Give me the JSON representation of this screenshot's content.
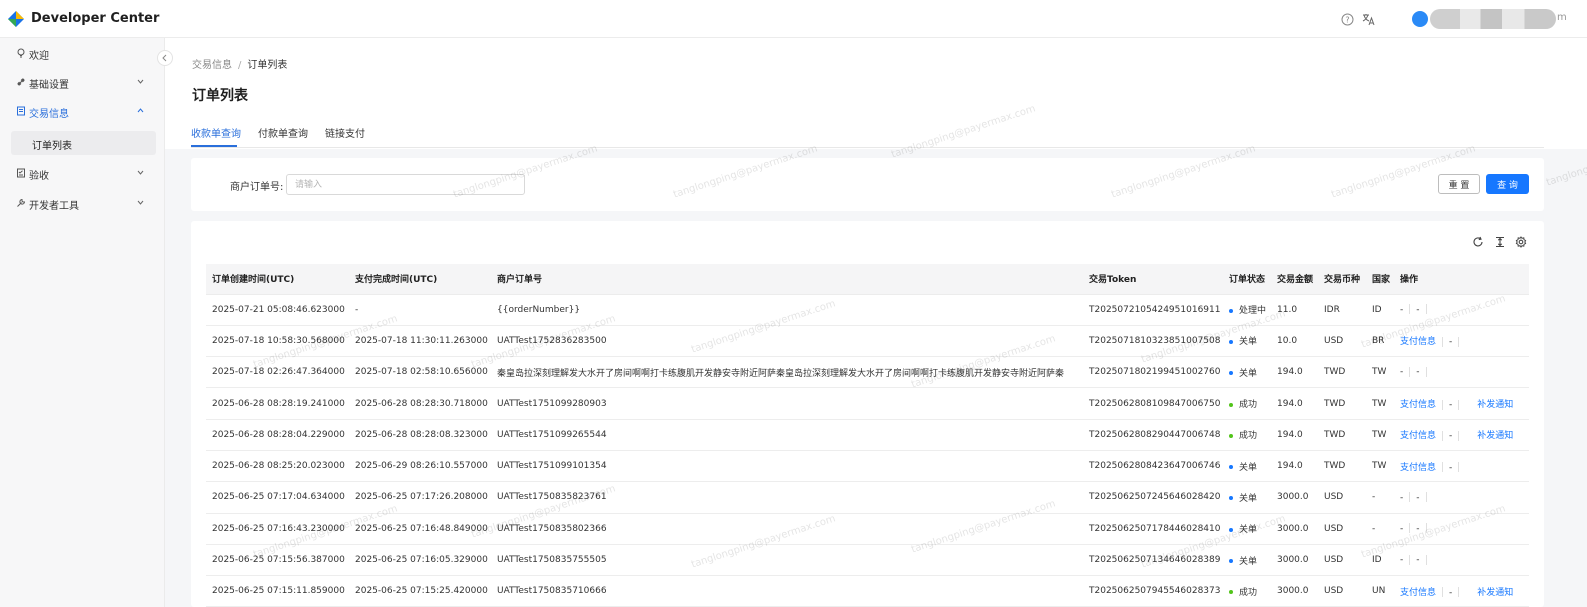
{
  "header": {
    "app_title": "Developer Center",
    "user_tail": "m",
    "icons": [
      "help-icon",
      "translate-icon",
      "user-avatar-icon"
    ]
  },
  "sidebar": {
    "items": [
      {
        "label": "欢迎",
        "icon": "bulb-icon"
      },
      {
        "label": "基础设置",
        "icon": "link-icon"
      },
      {
        "label": "交易信息",
        "icon": "document-icon",
        "active": true
      },
      {
        "label": "验收",
        "icon": "checklist-icon"
      },
      {
        "label": "开发者工具",
        "icon": "tool-icon"
      }
    ],
    "sub_item": "订单列表"
  },
  "breadcrumb": {
    "parent": "交易信息",
    "current": "订单列表"
  },
  "page_title": "订单列表",
  "tabs": [
    {
      "label": "收款单查询",
      "active": true
    },
    {
      "label": "付款单查询"
    },
    {
      "label": "链接支付"
    }
  ],
  "filter": {
    "label": "商户订单号:",
    "placeholder": "请输入",
    "value": "",
    "reset_label": "重 置",
    "query_label": "查 询"
  },
  "table": {
    "columns": [
      "订单创建时间(UTC)",
      "支付完成时间(UTC)",
      "商户订单号",
      "交易Token",
      "订单状态",
      "交易金额",
      "交易币种",
      "国家",
      "操作"
    ],
    "rows": [
      {
        "created": "2025-07-21 05:08:46.623000",
        "paid": "-",
        "order_no": "{{orderNumber}}",
        "token": "T2025072105424951016911",
        "status": "处理中",
        "amount": "11.0",
        "currency": "IDR",
        "country": "ID",
        "op_info": "-",
        "op_mid": "-",
        "op_notify": ""
      },
      {
        "created": "2025-07-18 10:58:30.568000",
        "paid": "2025-07-18 11:30:11.263000",
        "order_no": "UATTest1752836283500",
        "token": "T2025071810323851007508",
        "status": "关单",
        "amount": "10.0",
        "currency": "USD",
        "country": "BR",
        "op_info": "支付信息",
        "op_mid": "-",
        "op_notify": ""
      },
      {
        "created": "2025-07-18 02:26:47.364000",
        "paid": "2025-07-18 02:58:10.656000",
        "order_no": "秦皇岛拉深刻理解发大水开了房间啊啊打卡练腹肌开发静安寺附近阿萨秦皇岛拉深刻理解发大水开了房间啊啊打卡练腹肌开发静安寺附近阿萨秦",
        "token": "T2025071802199451002760",
        "status": "关单",
        "amount": "194.0",
        "currency": "TWD",
        "country": "TW",
        "op_info": "-",
        "op_mid": "-",
        "op_notify": ""
      },
      {
        "created": "2025-06-28 08:28:19.241000",
        "paid": "2025-06-28 08:28:30.718000",
        "order_no": "UATTest1751099280903",
        "token": "T2025062808109847006750",
        "status": "成功",
        "amount": "194.0",
        "currency": "TWD",
        "country": "TW",
        "op_info": "支付信息",
        "op_mid": "-",
        "op_notify": "补发通知"
      },
      {
        "created": "2025-06-28 08:28:04.229000",
        "paid": "2025-06-28 08:28:08.323000",
        "order_no": "UATTest1751099265544",
        "token": "T2025062808290447006748",
        "status": "成功",
        "amount": "194.0",
        "currency": "TWD",
        "country": "TW",
        "op_info": "支付信息",
        "op_mid": "-",
        "op_notify": "补发通知"
      },
      {
        "created": "2025-06-28 08:25:20.023000",
        "paid": "2025-06-29 08:26:10.557000",
        "order_no": "UATTest1751099101354",
        "token": "T2025062808423647006746",
        "status": "关单",
        "amount": "194.0",
        "currency": "TWD",
        "country": "TW",
        "op_info": "支付信息",
        "op_mid": "-",
        "op_notify": ""
      },
      {
        "created": "2025-06-25 07:17:04.634000",
        "paid": "2025-06-25 07:17:26.208000",
        "order_no": "UATTest1750835823761",
        "token": "T2025062507245646028420",
        "status": "关单",
        "amount": "3000.0",
        "currency": "USD",
        "country": "-",
        "op_info": "-",
        "op_mid": "-",
        "op_notify": ""
      },
      {
        "created": "2025-06-25 07:16:43.230000",
        "paid": "2025-06-25 07:16:48.849000",
        "order_no": "UATTest1750835802366",
        "token": "T2025062507178446028410",
        "status": "关单",
        "amount": "3000.0",
        "currency": "USD",
        "country": "-",
        "op_info": "-",
        "op_mid": "-",
        "op_notify": ""
      },
      {
        "created": "2025-06-25 07:15:56.387000",
        "paid": "2025-06-25 07:16:05.329000",
        "order_no": "UATTest1750835755505",
        "token": "T2025062507134646028389",
        "status": "关单",
        "amount": "3000.0",
        "currency": "USD",
        "country": "ID",
        "op_info": "-",
        "op_mid": "-",
        "op_notify": ""
      },
      {
        "created": "2025-06-25 07:15:11.859000",
        "paid": "2025-06-25 07:15:25.420000",
        "order_no": "UATTest1750835710666",
        "token": "T2025062507945546028373",
        "status": "成功",
        "amount": "3000.0",
        "currency": "USD",
        "country": "UN",
        "op_info": "支付信息",
        "op_mid": "-",
        "op_notify": "补发通知"
      }
    ]
  },
  "status_colors": {
    "处理中": "#1677ff",
    "关单": "#1677ff",
    "成功": "#52c41a"
  },
  "watermark": "tanglongping@payermax.com",
  "colors": {
    "accent": "#1677ff",
    "active_nav": "#2a6fdb"
  }
}
